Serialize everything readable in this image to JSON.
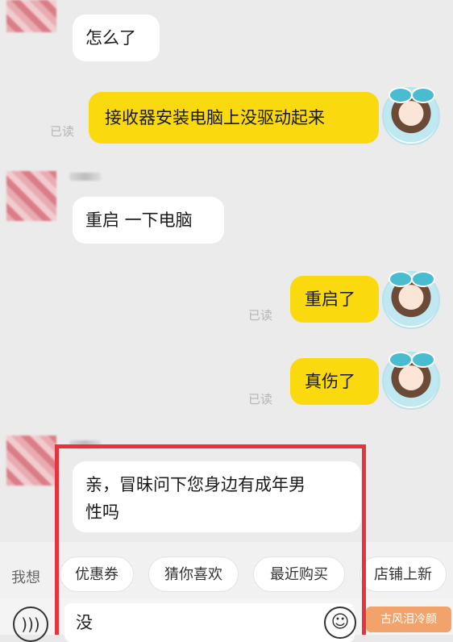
{
  "messages": {
    "m1": "怎么了",
    "m2": "接收器安装电脑上没驱动起来",
    "m3": "重启 一下电脑",
    "m4": "重启了",
    "m5": "真伤了",
    "m6_line1": "亲，冒昧问下您身边有成年男",
    "m6_line2": "性吗"
  },
  "read_label": "已读",
  "suggest": {
    "prefix": "我想",
    "chips": [
      "优惠券",
      "猜你喜欢",
      "最近购买",
      "店铺上新"
    ]
  },
  "input": {
    "value": "没"
  },
  "watermark": "古风泪冷颜"
}
